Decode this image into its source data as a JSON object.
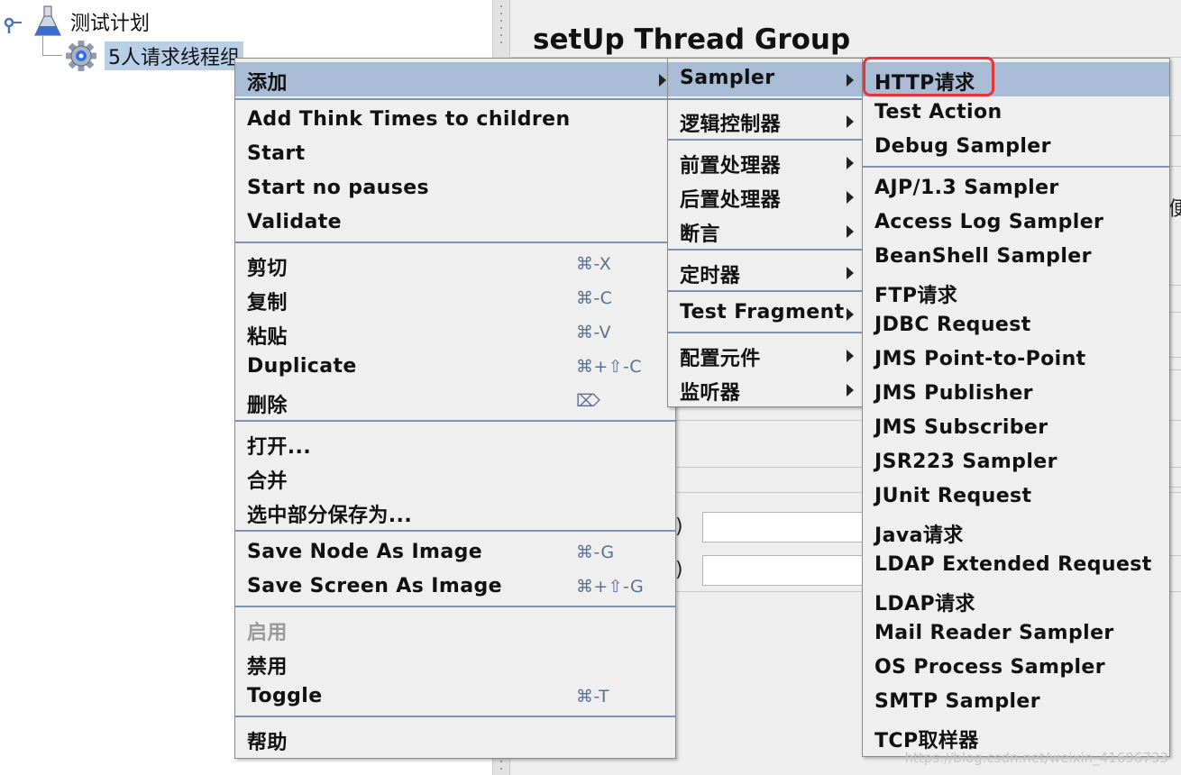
{
  "tree": {
    "root_label": "测试计划",
    "child_label": "5人请求线程组"
  },
  "panel": {
    "title": "setUp Thread Group",
    "edge_char": "便",
    "paren_1": ")",
    "paren_2": ")"
  },
  "context_menu": {
    "add": "添加",
    "add_think_times": "Add Think Times to children",
    "start": "Start",
    "start_no_pauses": "Start no pauses",
    "validate": "Validate",
    "cut": "剪切",
    "cut_shortcut": "⌘-X",
    "copy": "复制",
    "copy_shortcut": "⌘-C",
    "paste": "粘贴",
    "paste_shortcut": "⌘-V",
    "duplicate": "Duplicate",
    "duplicate_shortcut": "⌘+⇧-C",
    "delete": "删除",
    "delete_shortcut": "⌦",
    "open": "打开...",
    "merge": "合并",
    "save_selection_as": "选中部分保存为...",
    "save_node_as_image": "Save Node As Image",
    "save_node_shortcut": "⌘-G",
    "save_screen_as_image": "Save Screen As Image",
    "save_screen_shortcut": "⌘+⇧-G",
    "enable": "启用",
    "disable": "禁用",
    "toggle": "Toggle",
    "toggle_shortcut": "⌘-T",
    "help": "帮助"
  },
  "add_submenu": {
    "sampler": "Sampler",
    "logic_controller": "逻辑控制器",
    "pre_processors": "前置处理器",
    "post_processors": "后置处理器",
    "assertions": "断言",
    "timer": "定时器",
    "test_fragment": "Test Fragment",
    "config_element": "配置元件",
    "listener": "监听器"
  },
  "sampler_submenu": {
    "items": [
      "HTTP请求",
      "Test Action",
      "Debug Sampler",
      "AJP/1.3 Sampler",
      "Access Log Sampler",
      "BeanShell Sampler",
      "FTP请求",
      "JDBC Request",
      "JMS Point-to-Point",
      "JMS Publisher",
      "JMS Subscriber",
      "JSR223 Sampler",
      "JUnit Request",
      "Java请求",
      "LDAP Extended Request",
      "LDAP请求",
      "Mail Reader Sampler",
      "OS Process Sampler",
      "SMTP Sampler",
      "TCP取样器"
    ]
  },
  "watermark": "https://blog.csdn.net/weixin_41696733",
  "colors": {
    "menu_highlight": "#a9bcd5",
    "separator": "#7d94b5",
    "callout_border": "#e8333b",
    "tree_selection": "#b9cfe7"
  }
}
